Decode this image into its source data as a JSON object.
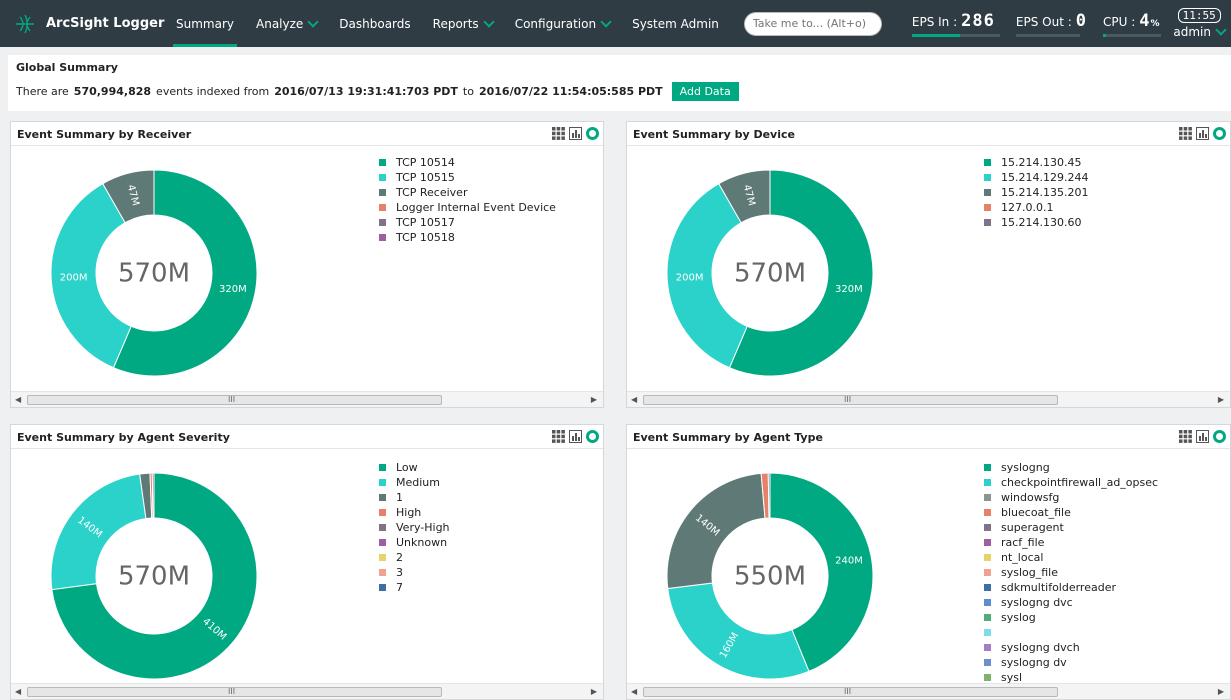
{
  "nav": {
    "brand": "ArcSight Logger",
    "menu": [
      {
        "label": "Summary",
        "active": true,
        "dropdown": false
      },
      {
        "label": "Analyze",
        "active": false,
        "dropdown": true
      },
      {
        "label": "Dashboards",
        "active": false,
        "dropdown": false
      },
      {
        "label": "Reports",
        "active": false,
        "dropdown": true
      },
      {
        "label": "Configuration",
        "active": false,
        "dropdown": true
      },
      {
        "label": "System Admin",
        "active": false,
        "dropdown": false
      }
    ],
    "search_placeholder": "Take me to... (Alt+o)",
    "eps_in_label": "EPS In :",
    "eps_in_value": "286",
    "eps_in_level": 0.55,
    "eps_out_label": "EPS Out :",
    "eps_out_value": "0",
    "eps_out_level": 0.0,
    "cpu_label": "CPU :",
    "cpu_value": "4",
    "cpu_unit": "%",
    "cpu_level": 0.04,
    "clock": "11:55",
    "user": "admin"
  },
  "global": {
    "title": "Global Summary",
    "prefix": "There are",
    "count": "570,994,828",
    "middle": "events indexed from",
    "from": "2016/07/13 19:31:41:703 PDT",
    "to_word": "to",
    "to": "2016/07/22 11:54:05:585 PDT",
    "add_button": "Add Data"
  },
  "panels": [
    {
      "id": "receiver",
      "title": "Event Summary by Receiver",
      "total": "570M",
      "legend": [
        "TCP 10514",
        "TCP 10515",
        "TCP Receiver",
        "Logger Internal Event Device",
        "TCP 10517",
        "TCP 10518"
      ],
      "segments": [
        {
          "value": 320,
          "label": "320M",
          "color": "#01a982"
        },
        {
          "value": 200,
          "label": "200M",
          "color": "#2ad2c9"
        },
        {
          "value": 47,
          "label": "47M",
          "color": "#5f7a76"
        }
      ],
      "legend_colors": [
        "#01a982",
        "#2ad2c9",
        "#5f7a76",
        "#e5836a",
        "#80728a",
        "#9e5fa0"
      ]
    },
    {
      "id": "device",
      "title": "Event Summary by Device",
      "total": "570M",
      "legend": [
        "15.214.130.45",
        "15.214.129.244",
        "15.214.135.201",
        "127.0.0.1",
        "15.214.130.60"
      ],
      "segments": [
        {
          "value": 320,
          "label": "320M",
          "color": "#01a982"
        },
        {
          "value": 200,
          "label": "200M",
          "color": "#2ad2c9"
        },
        {
          "value": 47,
          "label": "47M",
          "color": "#5f7a76"
        }
      ],
      "legend_colors": [
        "#01a982",
        "#2ad2c9",
        "#5f7a76",
        "#e5836a",
        "#80728a"
      ]
    },
    {
      "id": "severity",
      "title": "Event Summary by Agent Severity",
      "total": "570M",
      "legend": [
        "Low",
        "Medium",
        "1",
        "High",
        "Very-High",
        "Unknown",
        "2",
        "3",
        "7"
      ],
      "segments": [
        {
          "value": 410,
          "label": "410M",
          "color": "#01a982"
        },
        {
          "value": 140,
          "label": "140M",
          "color": "#2ad2c9"
        },
        {
          "value": 9,
          "label": "",
          "color": "#5f7a76"
        },
        {
          "value": 2,
          "label": "",
          "color": "#e5836a"
        },
        {
          "value": 1.5,
          "label": "",
          "color": "#80728a"
        }
      ],
      "legend_colors": [
        "#01a982",
        "#2ad2c9",
        "#5f7a76",
        "#e5836a",
        "#80728a",
        "#9e5fa0",
        "#e8d36b",
        "#f2a18e",
        "#3f6ea3"
      ]
    },
    {
      "id": "agenttype",
      "title": "Event Summary by Agent Type",
      "total": "550M",
      "legend": [
        "syslogng",
        "checkpointfirewall_ad_opsec",
        "windowsfg",
        "bluecoat_file",
        "superagent",
        "racf_file",
        "nt_local",
        "syslog_file",
        "sdkmultifolderreader",
        "syslogng dvc",
        "syslog",
        "",
        "syslogng dvch",
        "syslogng dv",
        "sysl"
      ],
      "segments": [
        {
          "value": 240,
          "label": "240M",
          "color": "#01a982"
        },
        {
          "value": 160,
          "label": "160M",
          "color": "#2ad2c9"
        },
        {
          "value": 140,
          "label": "140M",
          "color": "#5f7a76"
        },
        {
          "value": 6,
          "label": "",
          "color": "#e5836a"
        },
        {
          "value": 1.5,
          "label": "",
          "color": "#80728a"
        }
      ],
      "legend_colors": [
        "#01a982",
        "#2ad2c9",
        "#8a9594",
        "#e5836a",
        "#80728a",
        "#9e5fa0",
        "#e8d36b",
        "#f2a18e",
        "#3f6ea3",
        "#5b8fd1",
        "#4fae7a",
        "#7fdde8",
        "#a57fc4",
        "#6f8fc9",
        "#7fb36b"
      ]
    }
  ]
}
